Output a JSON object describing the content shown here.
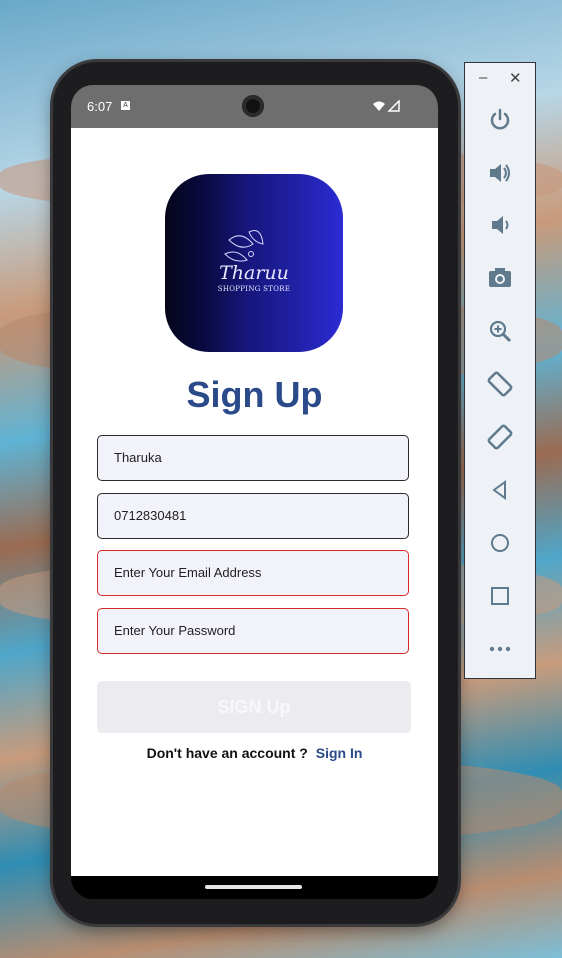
{
  "status_bar": {
    "time": "6:07",
    "notif_glyph": "A"
  },
  "logo": {
    "title": "Tharuu",
    "subtitle": "SHOPPING STORE"
  },
  "form": {
    "heading": "Sign Up",
    "name_value": "Tharuka",
    "phone_value": "0712830481",
    "email_placeholder": "Enter Your Email Address",
    "password_placeholder": "Enter Your Password",
    "submit_label": "SIGN Up",
    "footer_question": "Don't have an account ?",
    "footer_link": "Sign In"
  },
  "panel": {
    "minimize": "–",
    "close": "✕",
    "tools": [
      "power-icon",
      "volume-up-icon",
      "volume-down-icon",
      "camera-icon",
      "zoom-in-icon",
      "rotate-left-icon",
      "rotate-right-icon",
      "back-icon",
      "home-icon",
      "overview-icon",
      "more-icon"
    ]
  },
  "colors": {
    "heading": "#2b4a8a",
    "error_border": "#d92a2a",
    "field_bg": "#f2f2fb",
    "button_disabled": "#ecebf0"
  }
}
